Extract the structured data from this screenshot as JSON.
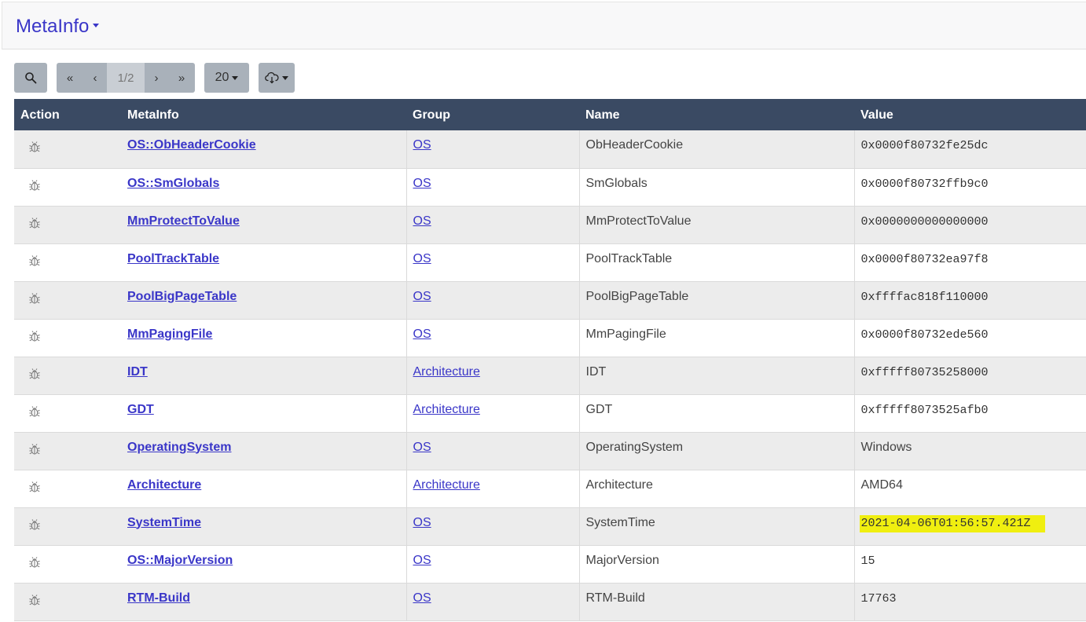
{
  "header": {
    "title": "MetaInfo"
  },
  "toolbar": {
    "search_icon": "search-icon",
    "pager": {
      "first": "«",
      "prev": "‹",
      "current": "1/2",
      "next": "›",
      "last": "»"
    },
    "page_size": "20",
    "download_icon": "cloud-download-icon"
  },
  "table": {
    "columns": [
      "Action",
      "MetaInfo",
      "Group",
      "Name",
      "Value"
    ],
    "rows": [
      {
        "meta": "OS::ObHeaderCookie",
        "group": "OS",
        "name": "ObHeaderCookie",
        "value": "0x0000f80732fe25dc"
      },
      {
        "meta": "OS::SmGlobals",
        "group": "OS",
        "name": "SmGlobals",
        "value": "0x0000f80732ffb9c0"
      },
      {
        "meta": "MmProtectToValue",
        "group": "OS",
        "name": "MmProtectToValue",
        "value": "0x0000000000000000"
      },
      {
        "meta": "PoolTrackTable",
        "group": "OS",
        "name": "PoolTrackTable",
        "value": "0x0000f80732ea97f8"
      },
      {
        "meta": "PoolBigPageTable",
        "group": "OS",
        "name": "PoolBigPageTable",
        "value": "0xffffac818f110000"
      },
      {
        "meta": "MmPagingFile",
        "group": "OS",
        "name": "MmPagingFile",
        "value": "0x0000f80732ede560"
      },
      {
        "meta": "IDT",
        "group": "Architecture",
        "name": "IDT",
        "value": "0xfffff80735258000"
      },
      {
        "meta": "GDT",
        "group": "Architecture",
        "name": "GDT",
        "value": "0xfffff8073525afb0"
      },
      {
        "meta": "OperatingSystem",
        "group": "OS",
        "name": "OperatingSystem",
        "value": "Windows"
      },
      {
        "meta": "Architecture",
        "group": "Architecture",
        "name": "Architecture",
        "value": "AMD64"
      },
      {
        "meta": "SystemTime",
        "group": "OS",
        "name": "SystemTime",
        "value": "2021-04-06T01:56:57.421Z"
      },
      {
        "meta": "OS::MajorVersion",
        "group": "OS",
        "name": "MajorVersion",
        "value": "15"
      },
      {
        "meta": "RTM-Build",
        "group": "OS",
        "name": "RTM-Build",
        "value": "17763"
      }
    ]
  },
  "colors": {
    "accent": "#3a36c8",
    "header_bg": "#3a4a63",
    "button_bg": "#a9b1ba",
    "highlight": "#f0ef10"
  }
}
